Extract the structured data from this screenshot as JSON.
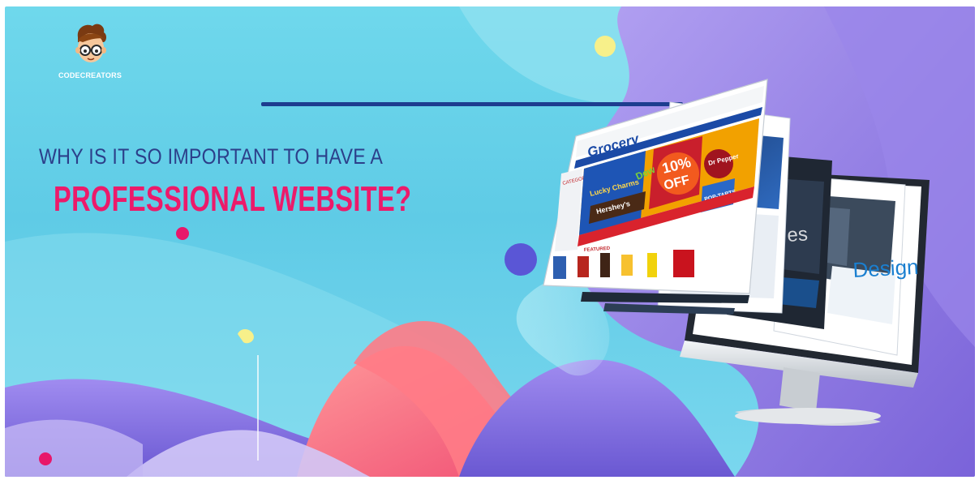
{
  "brand": {
    "name": "CODECREATORS",
    "mascot_icon": "cartoon-boy-with-glasses"
  },
  "headline": {
    "line1": "WHY IS IT SO IMPORTANT TO HAVE A",
    "line2": "PROFESSIONAL WEBSITE?"
  },
  "website_mockup": {
    "site_logo": "Grocery",
    "promo_percent": "10%",
    "promo_word": "OFF",
    "product_1": "Lucky Charms",
    "product_2": "Dew",
    "product_3": "Hershey's",
    "product_4": "Dr Pepper",
    "product_5": "POP-TARTS",
    "section_featured": "FEATURED",
    "section_categories": "CATEGORIES",
    "pane_design_text": "Design",
    "pane_dark_text": "es"
  },
  "colors": {
    "sky": "#6fd8ec",
    "headline_dark": "#2c3f8a",
    "headline_pink": "#ec1a6a",
    "accent_purple": "#8b6fe0",
    "accent_pink": "#f0506e",
    "accent_yellow": "#f7f08a",
    "dot_magenta": "#e8176a",
    "dot_navy": "#5a56d6"
  }
}
